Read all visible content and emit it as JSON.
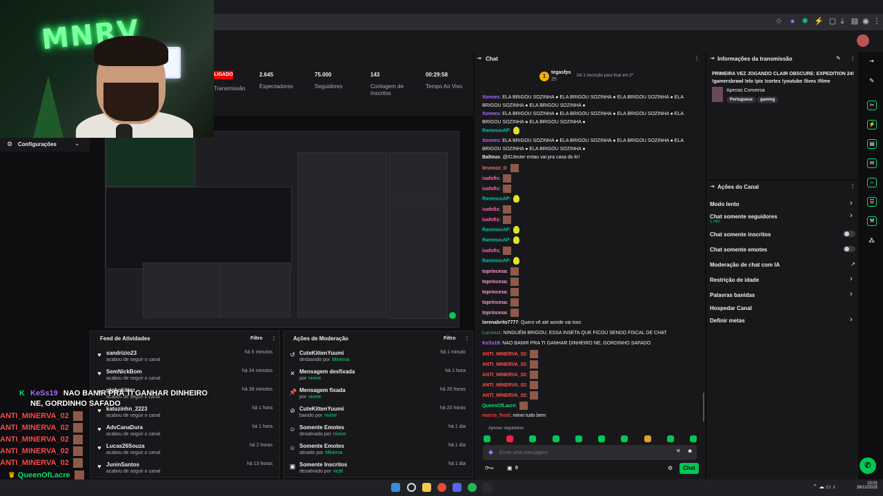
{
  "stats": {
    "live_label": "LIGADO",
    "transmission_label": "Transmissão",
    "items": [
      {
        "value": "2.645",
        "label": "Espectadores"
      },
      {
        "value": "75.000",
        "label": "Seguidores"
      },
      {
        "value": "143",
        "label": "Contagem de Inscritos"
      },
      {
        "value": "00:29:58",
        "label": "Tempo Ao Vivo"
      }
    ]
  },
  "webcam": {
    "logo_text": "MNRV"
  },
  "preview": {
    "config_label": "Configurações"
  },
  "activity_feed": {
    "title": "Feed de Atividades",
    "filter_label": "Filtro",
    "items": [
      {
        "name": "sandrizio23",
        "desc": "acabou de seguir o canal",
        "time": "há 5 minutos"
      },
      {
        "name": "SemNickBom",
        "desc": "acabou de seguir o canal",
        "time": "há 24 minutos"
      },
      {
        "name": "globokittzz",
        "desc": "acabou de seguir o canal",
        "time": "há 39 minutos"
      },
      {
        "name": "katuzinhn_2223",
        "desc": "acabou de seguir o canal",
        "time": "há 1 hora"
      },
      {
        "name": "AdvCanaDura",
        "desc": "acabou de seguir o canal",
        "time": "há 1 hora"
      },
      {
        "name": "Lucas26Souza",
        "desc": "acabou de seguir o canal",
        "time": "há 2 horas"
      },
      {
        "name": "JuninSantos",
        "desc": "acabou de seguir o canal",
        "time": "há 13 horas"
      }
    ]
  },
  "moderation": {
    "title": "Ações de Moderação",
    "filter_label": "Filtro",
    "items": [
      {
        "icon": "undo-icon",
        "glyph": "↺",
        "title": "CuteKittenYuumi",
        "action": "desbanido por",
        "by": "Minerva",
        "time": "há 1 minuto"
      },
      {
        "icon": "unpin-icon",
        "glyph": "✕",
        "title": "Mensagem desfixada",
        "action": "por",
        "by": "nivine",
        "time": "há 1 hora"
      },
      {
        "icon": "pin-icon",
        "glyph": "📌",
        "title": "Mensagem fixada",
        "action": "por",
        "by": "nivine",
        "time": "há 20 horas"
      },
      {
        "icon": "ban-icon",
        "glyph": "⊘",
        "title": "CuteKittenYuumi",
        "action": "banido por",
        "by": "nivine",
        "time": "há 20 horas"
      },
      {
        "icon": "emote-icon",
        "glyph": "☺",
        "title": "Somente Emotes",
        "action": "desativado por",
        "by": "nivine",
        "time": "há 1 dia"
      },
      {
        "icon": "emote-icon",
        "glyph": "☺",
        "title": "Somente Emotes",
        "action": "ativado por",
        "by": "Minerva",
        "time": "há 1 dia"
      },
      {
        "icon": "gift-icon",
        "glyph": "▣",
        "title": "Somente Inscritos",
        "action": "desativado por",
        "by": "victtl",
        "time": "há 1 dia"
      }
    ]
  },
  "chat": {
    "title": "Chat",
    "top_user": "tegasfps",
    "top_count": "25",
    "top_note": "Dê 1 inscrição para ficar em 2º",
    "followers_only": "Apenas seguidores",
    "input_placeholder": "Envie uma mensagem",
    "send_label": "Chat",
    "points": "0",
    "messages": [
      {
        "user": "Xonnes",
        "color": "#a970ff",
        "text": "ELA BRIGOU SOZINHA ● ELA BRIGOU SOZINHA ● ELA BRIGOU SOZINHA ● ELA BRIGOU SOZINHA ● ELA BRIGOU SOZINHA ●"
      },
      {
        "user": "Xonnes",
        "color": "#a970ff",
        "text": "ELA BRIGOU SOZINHA ● ELA BRIGOU SOZINHA ● ELA BRIGOU SOZINHA ● ELA BRIGOU SOZINHA ● ELA BRIGOU SOZINHA ●"
      },
      {
        "user": "RammusAP",
        "color": "#00c8af",
        "text": ""
      },
      {
        "user": "Xonnes",
        "color": "#a970ff",
        "text": "ELA BRIGOU SOZINHA ● ELA BRIGOU SOZINHA ● ELA BRIGOU SOZINHA ● ELA BRIGOU SOZINHA ● ELA BRIGOU SOZINHA ●"
      },
      {
        "user": "Baltous",
        "color": "#efeff1",
        "text": "@IDJester entao vai pra casa do kr!"
      },
      {
        "user": "brunozz_0",
        "color": "#ff6b6b",
        "text": ""
      },
      {
        "user": "isafofis",
        "color": "#ff69b4",
        "text": ""
      },
      {
        "user": "isafofis",
        "color": "#ff69b4",
        "text": ""
      },
      {
        "user": "RammusAP",
        "color": "#00c8af",
        "text": ""
      },
      {
        "user": "isafofis",
        "color": "#ff69b4",
        "text": ""
      },
      {
        "user": "isafofis",
        "color": "#ff69b4",
        "text": ""
      },
      {
        "user": "RammusAP",
        "color": "#00c8af",
        "text": ""
      },
      {
        "user": "RammusAP",
        "color": "#00c8af",
        "text": ""
      },
      {
        "user": "isafofis",
        "color": "#ff69b4",
        "text": ""
      },
      {
        "user": "RammusAP",
        "color": "#00c8af",
        "text": ""
      },
      {
        "user": "toprincesa",
        "color": "#ff9ad5",
        "text": ""
      },
      {
        "user": "toprincesa",
        "color": "#ff9ad5",
        "text": ""
      },
      {
        "user": "toprincesa",
        "color": "#ff9ad5",
        "text": ""
      },
      {
        "user": "toprincesa",
        "color": "#ff9ad5",
        "text": ""
      },
      {
        "user": "toprincesa",
        "color": "#ff9ad5",
        "text": ""
      },
      {
        "user": "lorenabrito7777",
        "color": "#efeff1",
        "text": "Quero vê até aonde vai isso"
      },
      {
        "user": "Luciuuz",
        "color": "#2e8b57",
        "text": "NINGUÉM BRIGOU, ESSA INSETA QUE FICOU SENDO FISCAL DE CHAT"
      },
      {
        "user": "KeSs19",
        "color": "#a970ff",
        "text": "NAO BANIR PRA TI GANHAR DINHEIRO NE, GORDINHO SAFADO"
      },
      {
        "user": "ANTI_MINERVA_02",
        "color": "#ff4d4d",
        "text": ""
      },
      {
        "user": "ANTI_MINERVA_02",
        "color": "#ff4d4d",
        "text": ""
      },
      {
        "user": "ANTI_MINERVA_02",
        "color": "#ff4d4d",
        "text": ""
      },
      {
        "user": "ANTI_MINERVA_02",
        "color": "#ff4d4d",
        "text": ""
      },
      {
        "user": "ANTI_MINERVA_02",
        "color": "#ff4d4d",
        "text": ""
      },
      {
        "user": "QueenOfLacre",
        "color": "#00e572",
        "text": ""
      },
      {
        "user": "marco_frost",
        "color": "#ff3b3b",
        "text": "minei tudo bem"
      }
    ]
  },
  "stream_info": {
    "title": "Informações da transmissão",
    "stream_title": "PRIMEIRA VEZ JOGANDO CLAIR OBSCURE: EXPEDITION 24! !gamersbrawl !elo !pix !cortes !youtube !lives !filme",
    "category": "Apenas Conversa",
    "tags": [
      "Portuguese",
      "gaming"
    ]
  },
  "channel_actions": {
    "title": "Ações do Canal",
    "items": [
      {
        "label": "Modo lento",
        "sub": "",
        "kind": "chevron"
      },
      {
        "label": "Chat somente seguidores",
        "sub": "1 min",
        "kind": "chevron"
      },
      {
        "label": "Chat somente inscritos",
        "sub": "",
        "kind": "toggle"
      },
      {
        "label": "Chat somente emotes",
        "sub": "",
        "kind": "toggle"
      },
      {
        "label": "Moderação de chat com IA",
        "sub": "",
        "kind": "external"
      },
      {
        "label": "Restrição de idade",
        "sub": "",
        "kind": "chevron"
      },
      {
        "label": "Palavras banidas",
        "sub": "",
        "kind": "chevron"
      },
      {
        "label": "Hospedar Canal",
        "sub": "",
        "kind": "none"
      },
      {
        "label": "Definir metas",
        "sub": "",
        "kind": "chevron"
      }
    ]
  },
  "overlay_chat": [
    {
      "user": "KeSs19",
      "color": "#a970ff",
      "text": "NAO BANIR PRA TI GANHAR DINHEIRO NE, GORDINHO SAFADO"
    },
    {
      "user": "ANTI_MINERVA_02",
      "color": "#ff4d4d",
      "text": ""
    },
    {
      "user": "ANTI_MINERVA_02",
      "color": "#ff4d4d",
      "text": ""
    },
    {
      "user": "ANTI_MINERVA_02",
      "color": "#ff4d4d",
      "text": ""
    },
    {
      "user": "ANTI_MINERVA_02",
      "color": "#ff4d4d",
      "text": ""
    },
    {
      "user": "ANTI_MINERVA_02",
      "color": "#ff4d4d",
      "text": ""
    },
    {
      "user": "QueenOfLacre",
      "color": "#00e572",
      "text": ""
    },
    {
      "user": "marco_frost",
      "color": "#ff3b3b",
      "text": "minei tudo bem"
    }
  ],
  "taskbar": {
    "time": "15:01",
    "date": "26/12/2025"
  },
  "colors": {
    "accent": "#00e572",
    "live": "#eb0400",
    "background": "#0e0e10",
    "panel": "#18181b"
  }
}
